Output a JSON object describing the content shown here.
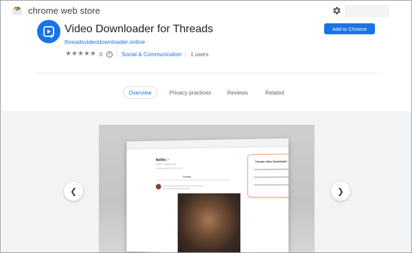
{
  "header": {
    "store_title": "chrome web store",
    "logo_icon": "chrome-web-store-logo",
    "settings_icon": "gear-icon"
  },
  "extension": {
    "title": "Video Downloader for Threads",
    "website": "threadsvideodownloader.online",
    "rating": 0,
    "rating_count": "0",
    "category": "Social & Communication",
    "users": "1 users",
    "add_button": "Add to Chrome",
    "icon": "video-download-icon"
  },
  "tabs": [
    {
      "label": "Overview",
      "active": true
    },
    {
      "label": "Privacy practices",
      "active": false
    },
    {
      "label": "Reviews",
      "active": false
    },
    {
      "label": "Related",
      "active": false
    }
  ],
  "gallery": {
    "prev_icon": "chevron-left-icon",
    "next_icon": "chevron-right-icon",
    "screenshot": {
      "profile_name": "Netflix ✓",
      "profile_handle": "netflix · threads.net",
      "tab_label": "Threads",
      "popup_title": "Threads Video Downloader"
    }
  },
  "colors": {
    "accent": "#1a73e8",
    "popup_border": "#f3a777",
    "gallery_bg": "#f1f3f4"
  }
}
